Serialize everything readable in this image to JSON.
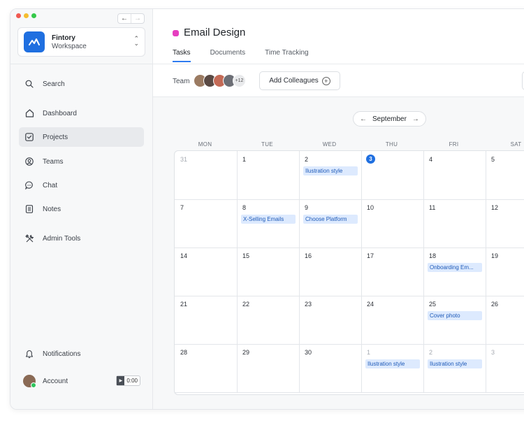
{
  "window": {
    "nav_back": "←",
    "nav_forward": "→"
  },
  "workspace": {
    "name": "Fintory",
    "subtitle": "Workspace",
    "switch_icon": "chevron-up-down"
  },
  "sidebar": {
    "items": [
      {
        "label": "Search",
        "icon": "search-icon"
      },
      {
        "label": "Dashboard",
        "icon": "home-icon"
      },
      {
        "label": "Projects",
        "icon": "checkbox-icon",
        "active": true
      },
      {
        "label": "Teams",
        "icon": "people-icon"
      },
      {
        "label": "Chat",
        "icon": "chat-bubble-icon"
      },
      {
        "label": "Notes",
        "icon": "notes-icon"
      },
      {
        "label": "Admin Tools",
        "icon": "tools-icon"
      }
    ],
    "notifications": "Notifications",
    "account": "Account",
    "timer": "0:00"
  },
  "project": {
    "title": "Email Design",
    "color": "#e63ec0",
    "tabs": [
      {
        "label": "Tasks",
        "active": true
      },
      {
        "label": "Documents"
      },
      {
        "label": "Time Tracking"
      }
    ]
  },
  "team": {
    "label": "Team",
    "extra_count": "+12",
    "add_label": "Add Colleagues",
    "add_icon": "+"
  },
  "calendar": {
    "month": "September",
    "prev": "←",
    "next": "→",
    "weekdays": [
      "MON",
      "TUE",
      "WED",
      "THU",
      "FRI",
      "SAT"
    ],
    "weeks": [
      [
        {
          "day": "31",
          "muted": true
        },
        {
          "day": "1"
        },
        {
          "day": "2",
          "event": "Ilustration style"
        },
        {
          "day": "3",
          "today": true
        },
        {
          "day": "4"
        },
        {
          "day": "5"
        }
      ],
      [
        {
          "day": "7"
        },
        {
          "day": "8",
          "event": "X-Selling Emails"
        },
        {
          "day": "9",
          "event": "Choose Platform"
        },
        {
          "day": "10"
        },
        {
          "day": "11"
        },
        {
          "day": "12"
        }
      ],
      [
        {
          "day": "14"
        },
        {
          "day": "15"
        },
        {
          "day": "16"
        },
        {
          "day": "17"
        },
        {
          "day": "18",
          "event": "Onboarding Em..."
        },
        {
          "day": "19"
        }
      ],
      [
        {
          "day": "21"
        },
        {
          "day": "22"
        },
        {
          "day": "23"
        },
        {
          "day": "24"
        },
        {
          "day": "25",
          "event": "Cover photo"
        },
        {
          "day": "26"
        }
      ],
      [
        {
          "day": "28"
        },
        {
          "day": "29"
        },
        {
          "day": "30"
        },
        {
          "day": "1",
          "muted": true,
          "event": "Ilustration style"
        },
        {
          "day": "2",
          "muted": true,
          "event": "Ilustration style"
        },
        {
          "day": "3",
          "muted": true
        }
      ]
    ]
  }
}
